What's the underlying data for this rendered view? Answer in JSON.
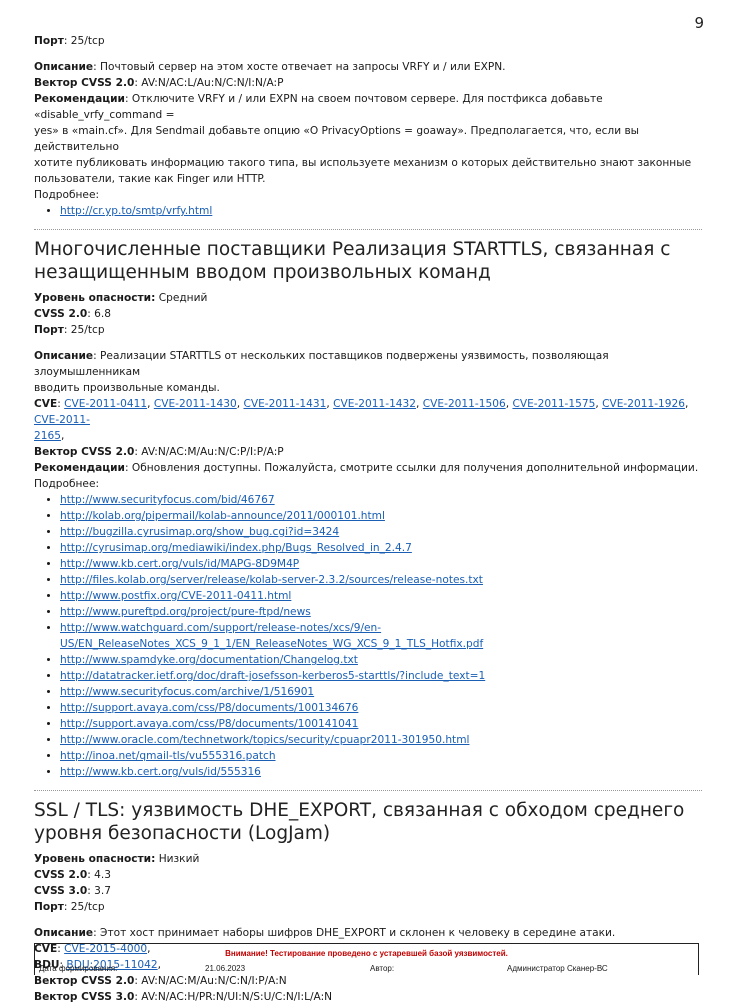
{
  "page_number": "9",
  "top": {
    "port_label": "Порт",
    "port_value": ": 25/tcp",
    "desc_label": "Описание",
    "desc_text": ": Почтовый сервер на этом хосте отвечает на запросы VRFY и / или EXPN.",
    "vector_label": "Вектор CVSS 2.0",
    "vector_text": ": AV:N/AC:L/Au:N/C:N/I:N/A:P",
    "rec_label": "Рекомендации",
    "rec_lines": [
      ": Отключите VRFY и / или EXPN на своем почтовом сервере. Для постфикса добавьте «disable_vrfy_command =",
      "yes» в «main.cf». Для Sendmail добавьте опцию «O PrivacyOptions = goaway». Предполагается, что, если вы действительно",
      "хотите публиковать информацию такого типа, вы используете механизм о которых действительно знают законные",
      "пользователи, такие как Finger или HTTP."
    ],
    "more": "Подробнее:",
    "links": [
      "http://cr.yp.to/smtp/vrfy.html"
    ]
  },
  "starttls": {
    "title_lines": [
      "Многочисленные поставщики Реализация STARTTLS, связанная с",
      "незащищенным вводом произвольных команд"
    ],
    "severity_label": "Уровень опасности:",
    "severity_value": " Средний",
    "cvss2_label": "CVSS 2.0",
    "cvss2_value": ": 6.8",
    "port_label": "Порт",
    "port_value": ": 25/tcp",
    "desc_label": "Описание",
    "desc_lines": [
      ": Реализации STARTTLS от нескольких поставщиков подвержены уязвимость, позволяющая злоумышленникам",
      "вводить произвольные команды."
    ],
    "cve_label": "CVE",
    "cves": [
      "CVE-2011-0411",
      "CVE-2011-1430",
      "CVE-2011-1431",
      "CVE-2011-1432",
      "CVE-2011-1506",
      "CVE-2011-1575",
      "CVE-2011-1926"
    ],
    "cve_last_line1": "CVE-2011-",
    "cve_last_line2": "2165",
    "vector_label": "Вектор CVSS 2.0",
    "vector_text": ": AV:N/AC:M/Au:N/C:P/I:P/A:P",
    "rec_label": "Рекомендации",
    "rec_text": ": Обновления доступны. Пожалуйста, смотрите ссылки для получения дополнительной информации.",
    "more": "Подробнее:",
    "links": [
      "http://www.securityfocus.com/bid/46767",
      "http://kolab.org/pipermail/kolab-announce/2011/000101.html",
      "http://bugzilla.cyrusimap.org/show_bug.cgi?id=3424",
      "http://cyrusimap.org/mediawiki/index.php/Bugs_Resolved_in_2.4.7",
      "http://www.kb.cert.org/vuls/id/MAPG-8D9M4P",
      "http://files.kolab.org/server/release/kolab-server-2.3.2/sources/release-notes.txt",
      "http://www.postfix.org/CVE-2011-0411.html",
      "http://www.pureftpd.org/project/pure-ftpd/news"
    ],
    "watchguard_line1": "http://www.watchguard.com/support/release-notes/xcs/9/en-",
    "watchguard_line2": "US/EN_ReleaseNotes_XCS_9_1_1/EN_ReleaseNotes_WG_XCS_9_1_TLS_Hotfix.pdf",
    "links2": [
      "http://www.spamdyke.org/documentation/Changelog.txt",
      "http://datatracker.ietf.org/doc/draft-josefsson-kerberos5-starttls/?include_text=1",
      "http://www.securityfocus.com/archive/1/516901",
      "http://support.avaya.com/css/P8/documents/100134676",
      "http://support.avaya.com/css/P8/documents/100141041",
      "http://www.oracle.com/technetwork/topics/security/cpuapr2011-301950.html",
      "http://inoa.net/qmail-tls/vu555316.patch",
      "http://www.kb.cert.org/vuls/id/555316"
    ]
  },
  "logjam": {
    "title_lines": [
      "SSL / TLS: уязвимость DHE_EXPORT, связанная с обходом среднего",
      "уровня безопасности (LogJam)"
    ],
    "severity_label": "Уровень опасности:",
    "severity_value": " Низкий",
    "cvss2_label": "CVSS 2.0",
    "cvss2_value": ": 4.3",
    "cvss3_label": "CVSS 3.0",
    "cvss3_value": ": 3.7",
    "port_label": "Порт",
    "port_value": ": 25/tcp",
    "desc_label": "Описание",
    "desc_text": ": Этот хост принимает наборы шифров DHE_EXPORT и склонен к человеку в середине атаки.",
    "cve_label": "CVE",
    "cve_value": "CVE-2015-4000",
    "bdu_label": "BDU",
    "bdu_value": "BDU:2015-11042",
    "vector2_label": "Вектор CVSS 2.0",
    "vector2_text": ": AV:N/AC:M/Au:N/C:N/I:P/A:N",
    "vector3_label": "Вектор CVSS 3.0",
    "vector3_text": ": AV:N/AC:H/PR:N/UI:N/S:U/C:N/I:L/A:N"
  },
  "footer": {
    "warning": "Внимание! Тестирование проведено с устаревшей базой уязвимостей.",
    "date_label": "Дата формирования:",
    "date_value": "21.06.2023",
    "author_label": "Автор:",
    "author_value": "Администратор Сканер-ВС"
  }
}
